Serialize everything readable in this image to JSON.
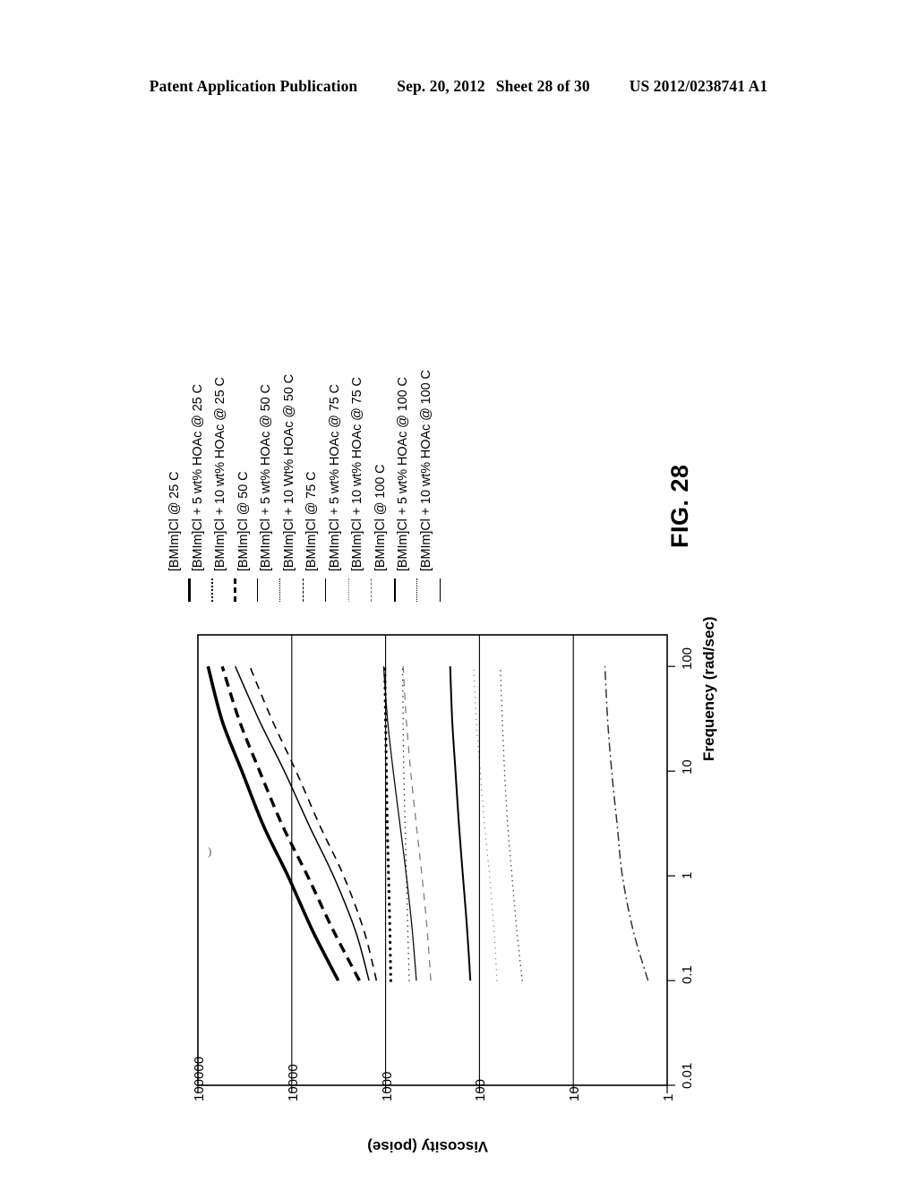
{
  "header": {
    "publication": "Patent Application Publication",
    "date": "Sep. 20, 2012",
    "sheet": "Sheet 28 of 30",
    "number": "US 2012/0238741 A1"
  },
  "figure": {
    "caption": "FIG. 28"
  },
  "legend": {
    "entries": [
      {
        "label": "[BMIm]Cl @ 25 C",
        "style": "ls-thick-solid"
      },
      {
        "label": "[BMIm]Cl + 5 wt% HOAc @ 25 C",
        "style": "ls-dotted"
      },
      {
        "label": "[BMIm]Cl + 10 wt% HOAc @ 25 C",
        "style": "ls-thick-dash"
      },
      {
        "label": "[BMIm]Cl @ 50 C",
        "style": "ls-solid"
      },
      {
        "label": "[BMIm]Cl + 5 wt% HOAc @ 50 C",
        "style": "ls-fine-dot"
      },
      {
        "label": "[BMIm]Cl + 10 Wt% HOAc @ 50 C",
        "style": "ls-dashed"
      },
      {
        "label": "[BMIm]Cl @ 75 C",
        "style": "ls-solid"
      },
      {
        "label": "[BMIm]Cl + 5 wt% HOAc @ 75 C",
        "style": "ls-faint-dot"
      },
      {
        "label": "[BMIm]Cl + 10 wt% HOAc @ 75 C",
        "style": "ls-faint-dash"
      },
      {
        "label": "[BMIm]Cl @ 100 C",
        "style": "ls-med-solid"
      },
      {
        "label": "[BMIm]Cl + 5 wt% HOAc @ 100 C",
        "style": "ls-fine-dot"
      },
      {
        "label": "[BMIm]Cl + 10 wt% HOAc @ 100 C",
        "style": "ls-solid"
      }
    ]
  },
  "chart_data": {
    "type": "line",
    "title": "FIG. 28",
    "orientation": "rotated-90-ccw",
    "xlabel": "Frequency (rad/sec)",
    "ylabel": "Viscosity (poise)",
    "xscale": "log",
    "yscale": "log",
    "xlim": [
      0.01,
      100
    ],
    "ylim": [
      1,
      100000
    ],
    "xticks": [
      "0.01",
      "0.1",
      "1",
      "10",
      "100"
    ],
    "yticks": [
      "100000",
      "10000",
      "1000",
      "100",
      "10",
      "1"
    ],
    "grid": true,
    "legend_position": "above-plot",
    "x": [
      0.1,
      0.3,
      1,
      3,
      10,
      30,
      100
    ],
    "series": [
      {
        "name": "[BMIm]Cl @ 25 C",
        "style": "thick-solid",
        "values": [
          3200,
          6000,
          11000,
          20000,
          34000,
          55000,
          78000
        ]
      },
      {
        "name": "[BMIm]Cl + 5 wt% HOAc @ 25 C",
        "style": "dotted",
        "values": [
          880,
          900,
          930,
          960,
          980,
          1000,
          1020
        ]
      },
      {
        "name": "[BMIm]Cl + 10 wt% HOAc @ 25 C",
        "style": "thick-dashed",
        "values": [
          1900,
          3600,
          6800,
          12500,
          22000,
          36000,
          55000
        ]
      },
      {
        "name": "[BMIm]Cl @ 50 C",
        "style": "solid",
        "values": [
          1500,
          2100,
          3600,
          6500,
          12000,
          22000,
          40000
        ]
      },
      {
        "name": "[BMIm]Cl + 5 wt% HOAc @ 50 C",
        "style": "fine-dotted",
        "values": [
          560,
          580,
          600,
          620,
          640,
          650,
          660
        ]
      },
      {
        "name": "[BMIm]Cl + 10 Wt% HOAc @ 50 C",
        "style": "dashed",
        "values": [
          1250,
          1700,
          2800,
          5000,
          9000,
          16000,
          28000
        ]
      },
      {
        "name": "[BMIm]Cl @ 75 C",
        "style": "solid-thin",
        "values": [
          470,
          520,
          600,
          700,
          830,
          950,
          1050
        ]
      },
      {
        "name": "[BMIm]Cl + 5 wt% HOAc @ 75 C",
        "style": "faint-dotted",
        "values": [
          65,
          70,
          78,
          88,
          98,
          108,
          115
        ]
      },
      {
        "name": "[BMIm]Cl + 10 wt% HOAc @ 75 C",
        "style": "faint-dashed",
        "values": [
          330,
          360,
          410,
          470,
          540,
          600,
          650
        ]
      },
      {
        "name": "[BMIm]Cl @ 100 C",
        "style": "medium-solid",
        "values": [
          125,
          135,
          150,
          165,
          180,
          195,
          205
        ]
      },
      {
        "name": "[BMIm]Cl + 5 wt% HOAc @ 100 C",
        "style": "fine-dotted-2",
        "values": [
          35,
          40,
          45,
          50,
          54,
          57,
          60
        ]
      },
      {
        "name": "[BMIm]Cl + 10 wt% HOAc @ 100 C",
        "style": "dash-dot",
        "values": [
          1.6,
          2.3,
          3.0,
          3.4,
          3.9,
          4.3,
          4.6
        ]
      }
    ]
  }
}
